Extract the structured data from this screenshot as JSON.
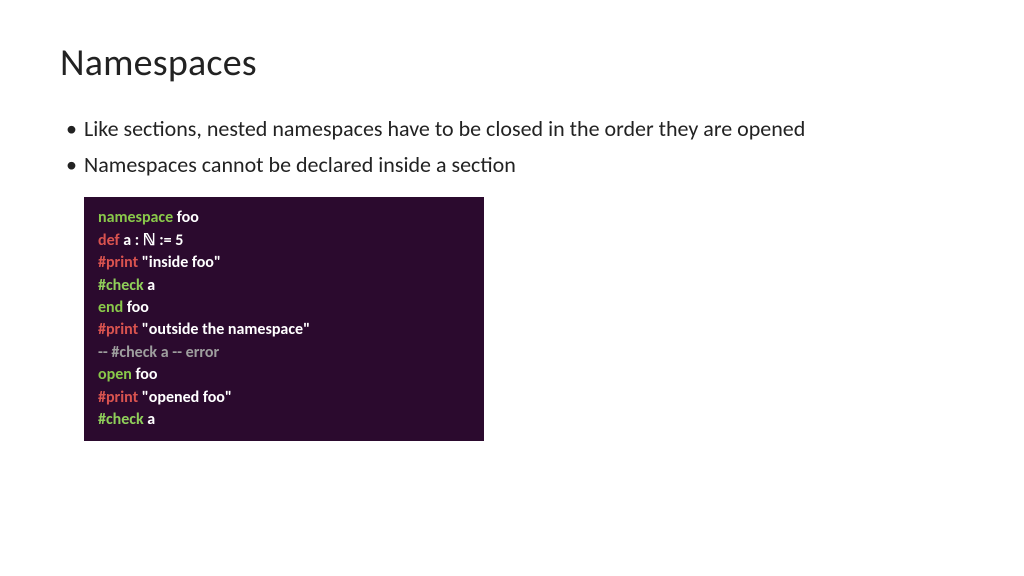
{
  "title": "Namespaces",
  "bullets": [
    "Like sections, nested namespaces have to be closed in the order they are opened",
    "Namespaces cannot be declared inside a section"
  ],
  "code": {
    "l1": {
      "kw": "namespace",
      "rest": " foo"
    },
    "l2": {
      "kw": "def",
      "rest": " a : ℕ := 5"
    },
    "l3": {
      "kw": "#print",
      "rest": " \"inside foo\""
    },
    "l4": {
      "kw": "#check",
      "rest": " a"
    },
    "l5": {
      "kw": "end",
      "rest": " foo"
    },
    "l6": {
      "kw": "#print",
      "rest": " \"outside the namespace\""
    },
    "l7": "-- #check a  -- error",
    "l8": {
      "kw": "open",
      "rest": " foo"
    },
    "l9": {
      "kw": "#print",
      "rest": " \"opened foo\""
    },
    "l10": {
      "kw": "#check",
      "rest": " a"
    }
  }
}
